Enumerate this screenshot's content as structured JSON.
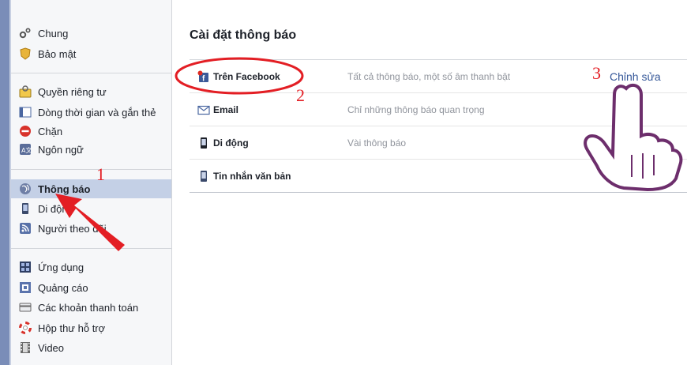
{
  "sidebar": {
    "groups": [
      [
        {
          "label": "Chung",
          "icon": "gears-icon"
        },
        {
          "label": "Bảo mật",
          "icon": "badge-icon"
        }
      ],
      [
        {
          "label": "Quyền riêng tư",
          "icon": "privacy-lock-icon"
        },
        {
          "label": "Dòng thời gian và gắn thẻ",
          "icon": "timeline-icon"
        },
        {
          "label": "Chặn",
          "icon": "block-icon"
        },
        {
          "label": "Ngôn ngữ",
          "icon": "language-icon"
        }
      ],
      [
        {
          "label": "Thông báo",
          "icon": "globe-icon",
          "active": true
        },
        {
          "label": "Di động",
          "icon": "mobile-icon"
        },
        {
          "label": "Người theo dõi",
          "icon": "rss-icon"
        }
      ],
      [
        {
          "label": "Ứng dụng",
          "icon": "apps-icon"
        },
        {
          "label": "Quảng cáo",
          "icon": "ads-icon"
        },
        {
          "label": "Các khoản thanh toán",
          "icon": "payment-card-icon"
        },
        {
          "label": "Hộp thư hỗ trợ",
          "icon": "lifebuoy-icon"
        },
        {
          "label": "Video",
          "icon": "film-icon"
        }
      ]
    ]
  },
  "main": {
    "title": "Cài đặt thông báo",
    "rows": [
      {
        "label": "Trên Facebook",
        "icon": "facebook-notification-icon",
        "desc": "Tất cả thông báo, một số âm thanh bật",
        "edit": "Chỉnh sửa"
      },
      {
        "label": "Email",
        "icon": "email-icon",
        "desc": "Chỉ những thông báo quan trọng",
        "edit": ""
      },
      {
        "label": "Di động",
        "icon": "mobile-icon",
        "desc": "Vài thông báo",
        "edit": ""
      },
      {
        "label": "Tin nhắn văn bản",
        "icon": "sms-icon",
        "desc": "",
        "edit": ""
      }
    ]
  },
  "annotations": {
    "step1": "1",
    "step2": "2",
    "step3": "3"
  },
  "colors": {
    "accent": "#365899",
    "annotation_red": "#e31e24",
    "active_bg": "#c4d0e6"
  }
}
